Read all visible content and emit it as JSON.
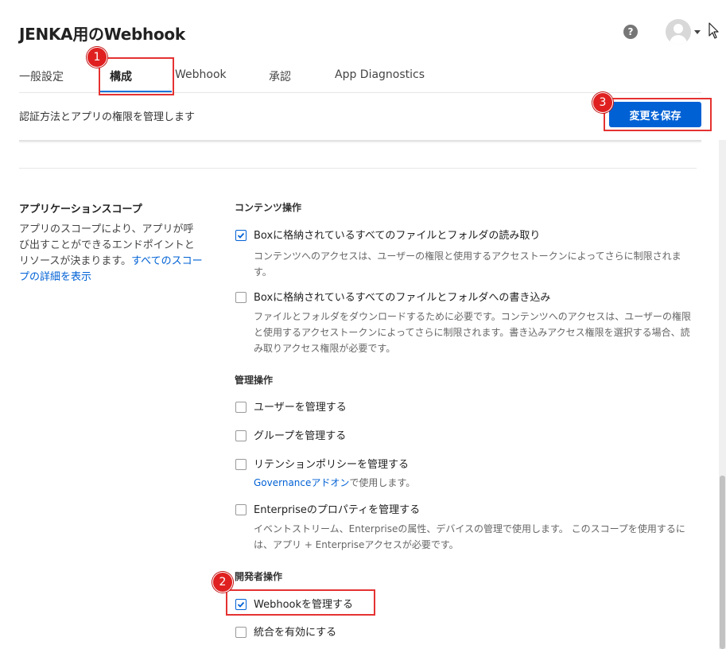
{
  "header": {
    "title": "JENKA用のWebhook",
    "help_icon": "question-icon",
    "help_glyph": "?",
    "avatar_icon": "user-avatar-icon"
  },
  "tabs": [
    {
      "label": "一般設定",
      "active": false
    },
    {
      "label": "構成",
      "active": true
    },
    {
      "label": "Webhook",
      "active": false
    },
    {
      "label": "承認",
      "active": false
    },
    {
      "label": "App Diagnostics",
      "active": false
    }
  ],
  "subheader": {
    "description": "認証方法とアプリの権限を管理します",
    "save_label": "変更を保存"
  },
  "scopes": {
    "title": "アプリケーションスコープ",
    "description": "アプリのスコープにより、アプリが呼び出すことができるエンドポイントとリソースが決まります。",
    "link_text": "すべてのスコープの詳細を表示",
    "content": {
      "title": "コンテンツ操作",
      "read": {
        "label": "Boxに格納されているすべてのファイルとフォルダの読み取り",
        "checked": true,
        "desc": "コンテンツへのアクセスは、ユーザーの権限と使用するアクセストークンによってさらに制限されます。"
      },
      "write": {
        "label": "Boxに格納されているすべてのファイルとフォルダへの書き込み",
        "checked": false,
        "desc": "ファイルとフォルダをダウンロードするために必要です。コンテンツへのアクセスは、ユーザーの権限と使用するアクセストークンによってさらに制限されます。書き込みアクセス権限を選択する場合、読み取りアクセス権限が必要です。"
      }
    },
    "admin": {
      "title": "管理操作",
      "users": {
        "label": "ユーザーを管理する",
        "checked": false
      },
      "groups": {
        "label": "グループを管理する",
        "checked": false
      },
      "retention": {
        "label": "リテンションポリシーを管理する",
        "checked": false,
        "desc_link": "Governanceアドオン",
        "desc_rest": "で使用します。"
      },
      "enterprise": {
        "label": "Enterpriseのプロパティを管理する",
        "checked": false,
        "desc": "イベントストリーム、Enterpriseの属性、デバイスの管理で使用します。 このスコープを使用するには、アプリ + Enterpriseアクセスが必要です。"
      }
    },
    "developer": {
      "title": "開発者操作",
      "webhook": {
        "label": "Webhookを管理する",
        "checked": true
      },
      "integrations": {
        "label": "統合を有効にする",
        "checked": false
      }
    }
  },
  "annotations": [
    {
      "number": "1",
      "target": "構成"
    },
    {
      "number": "2",
      "target": "Webhookを管理する"
    },
    {
      "number": "3",
      "target": "変更を保存"
    }
  ],
  "colors": {
    "primary": "#0061d5",
    "highlight": "#e53232",
    "tab_underline": "#1a74d9"
  }
}
